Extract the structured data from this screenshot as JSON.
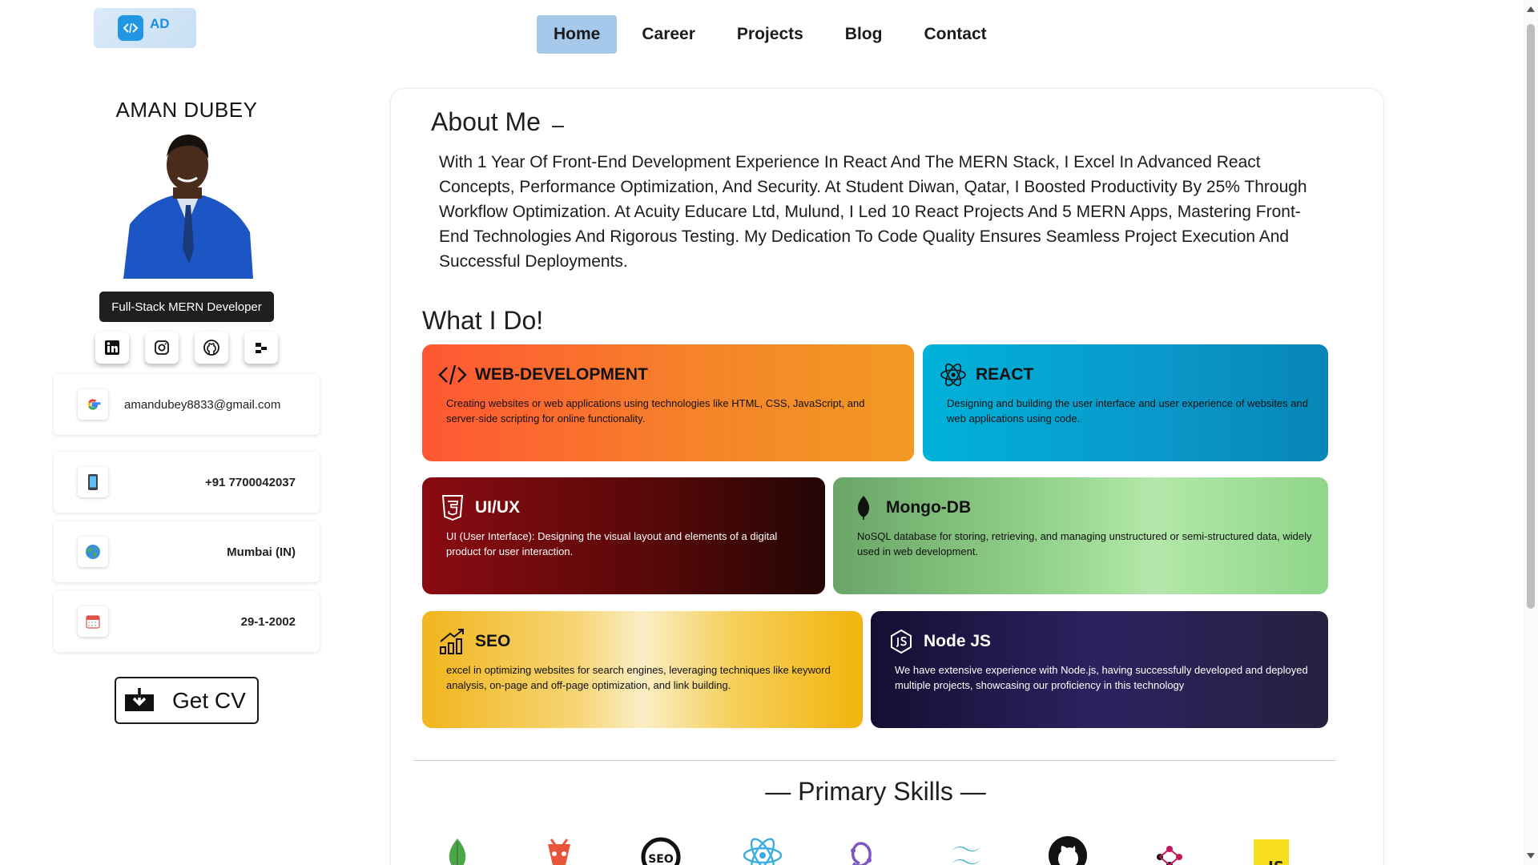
{
  "logo": {
    "text": "AD",
    "icon": "code-icon"
  },
  "nav": {
    "items": [
      {
        "label": "Home",
        "active": true
      },
      {
        "label": "Career",
        "active": false
      },
      {
        "label": "Projects",
        "active": false
      },
      {
        "label": "Blog",
        "active": false
      },
      {
        "label": "Contact",
        "active": false
      }
    ]
  },
  "profile": {
    "name": "AMAN DUBEY",
    "role": "Full-Stack MERN Developer",
    "socials": [
      "linkedin-icon",
      "instagram-icon",
      "github-icon",
      "dev-profile-icon"
    ],
    "email": "amandubey8833@gmail.com",
    "phone": "+91 7700042037",
    "location": "Mumbai (IN)",
    "dob": "29-1-2002",
    "cv_label": "Get CV"
  },
  "about": {
    "title": "About Me",
    "text": "With 1 Year Of Front-End Development Experience In React And The MERN Stack, I Excel In Advanced React Concepts, Performance Optimization, And Security. At Student Diwan, Qatar, I Boosted Productivity By 25% Through Workflow Optimization. At Acuity Educare Ltd, Mulund, I Led 10 React Projects And 5 MERN Apps, Mastering Front-End Technologies And Rigorous Testing. My Dedication To Code Quality Ensures Seamless Project Execution And Successful Deployments."
  },
  "whatido": {
    "title": "What I Do!",
    "services": [
      {
        "title": "WEB-DEVELOPMENT",
        "desc": "Creating websites or web applications using technologies like HTML, CSS, JavaScript, and server-side scripting for online functionality.",
        "icon": "code-icon",
        "color": "#f7702c"
      },
      {
        "title": "REACT",
        "desc": "Designing and building the user interface and user experience of websites and web applications using code.",
        "icon": "react-icon",
        "color": "#0aa6d4"
      },
      {
        "title": "UI/UX",
        "desc": "UI (User Interface): Designing the visual layout and elements of a digital product for user interaction.",
        "icon": "html5-icon",
        "color": "#7a0d0d"
      },
      {
        "title": "Mongo-DB",
        "desc": "NoSQL database for storing, retrieving, and managing unstructured or semi-structured data, widely used in web development.",
        "icon": "mongodb-leaf-icon",
        "color": "#8fd48a"
      },
      {
        "title": "SEO",
        "desc": "excel in optimizing websites for search engines, leveraging techniques like keyword analysis, on-page and off-page optimization, and link building.",
        "icon": "growth-chart-icon",
        "color": "#f3c22e"
      },
      {
        "title": "Node JS",
        "desc": "We have extensive experience with Node.js, having successfully developed and deployed multiple projects, showcasing our proficiency in this technology",
        "icon": "nodejs-icon",
        "color": "#231c4a"
      }
    ]
  },
  "skills": {
    "title": "Primary Skills",
    "icons": [
      "mongodb-icon",
      "express-icon",
      "seo-icon",
      "react-icon",
      "redux-icon",
      "tailwind-icon",
      "github-icon",
      "graphql-icon",
      "javascript-icon"
    ]
  }
}
